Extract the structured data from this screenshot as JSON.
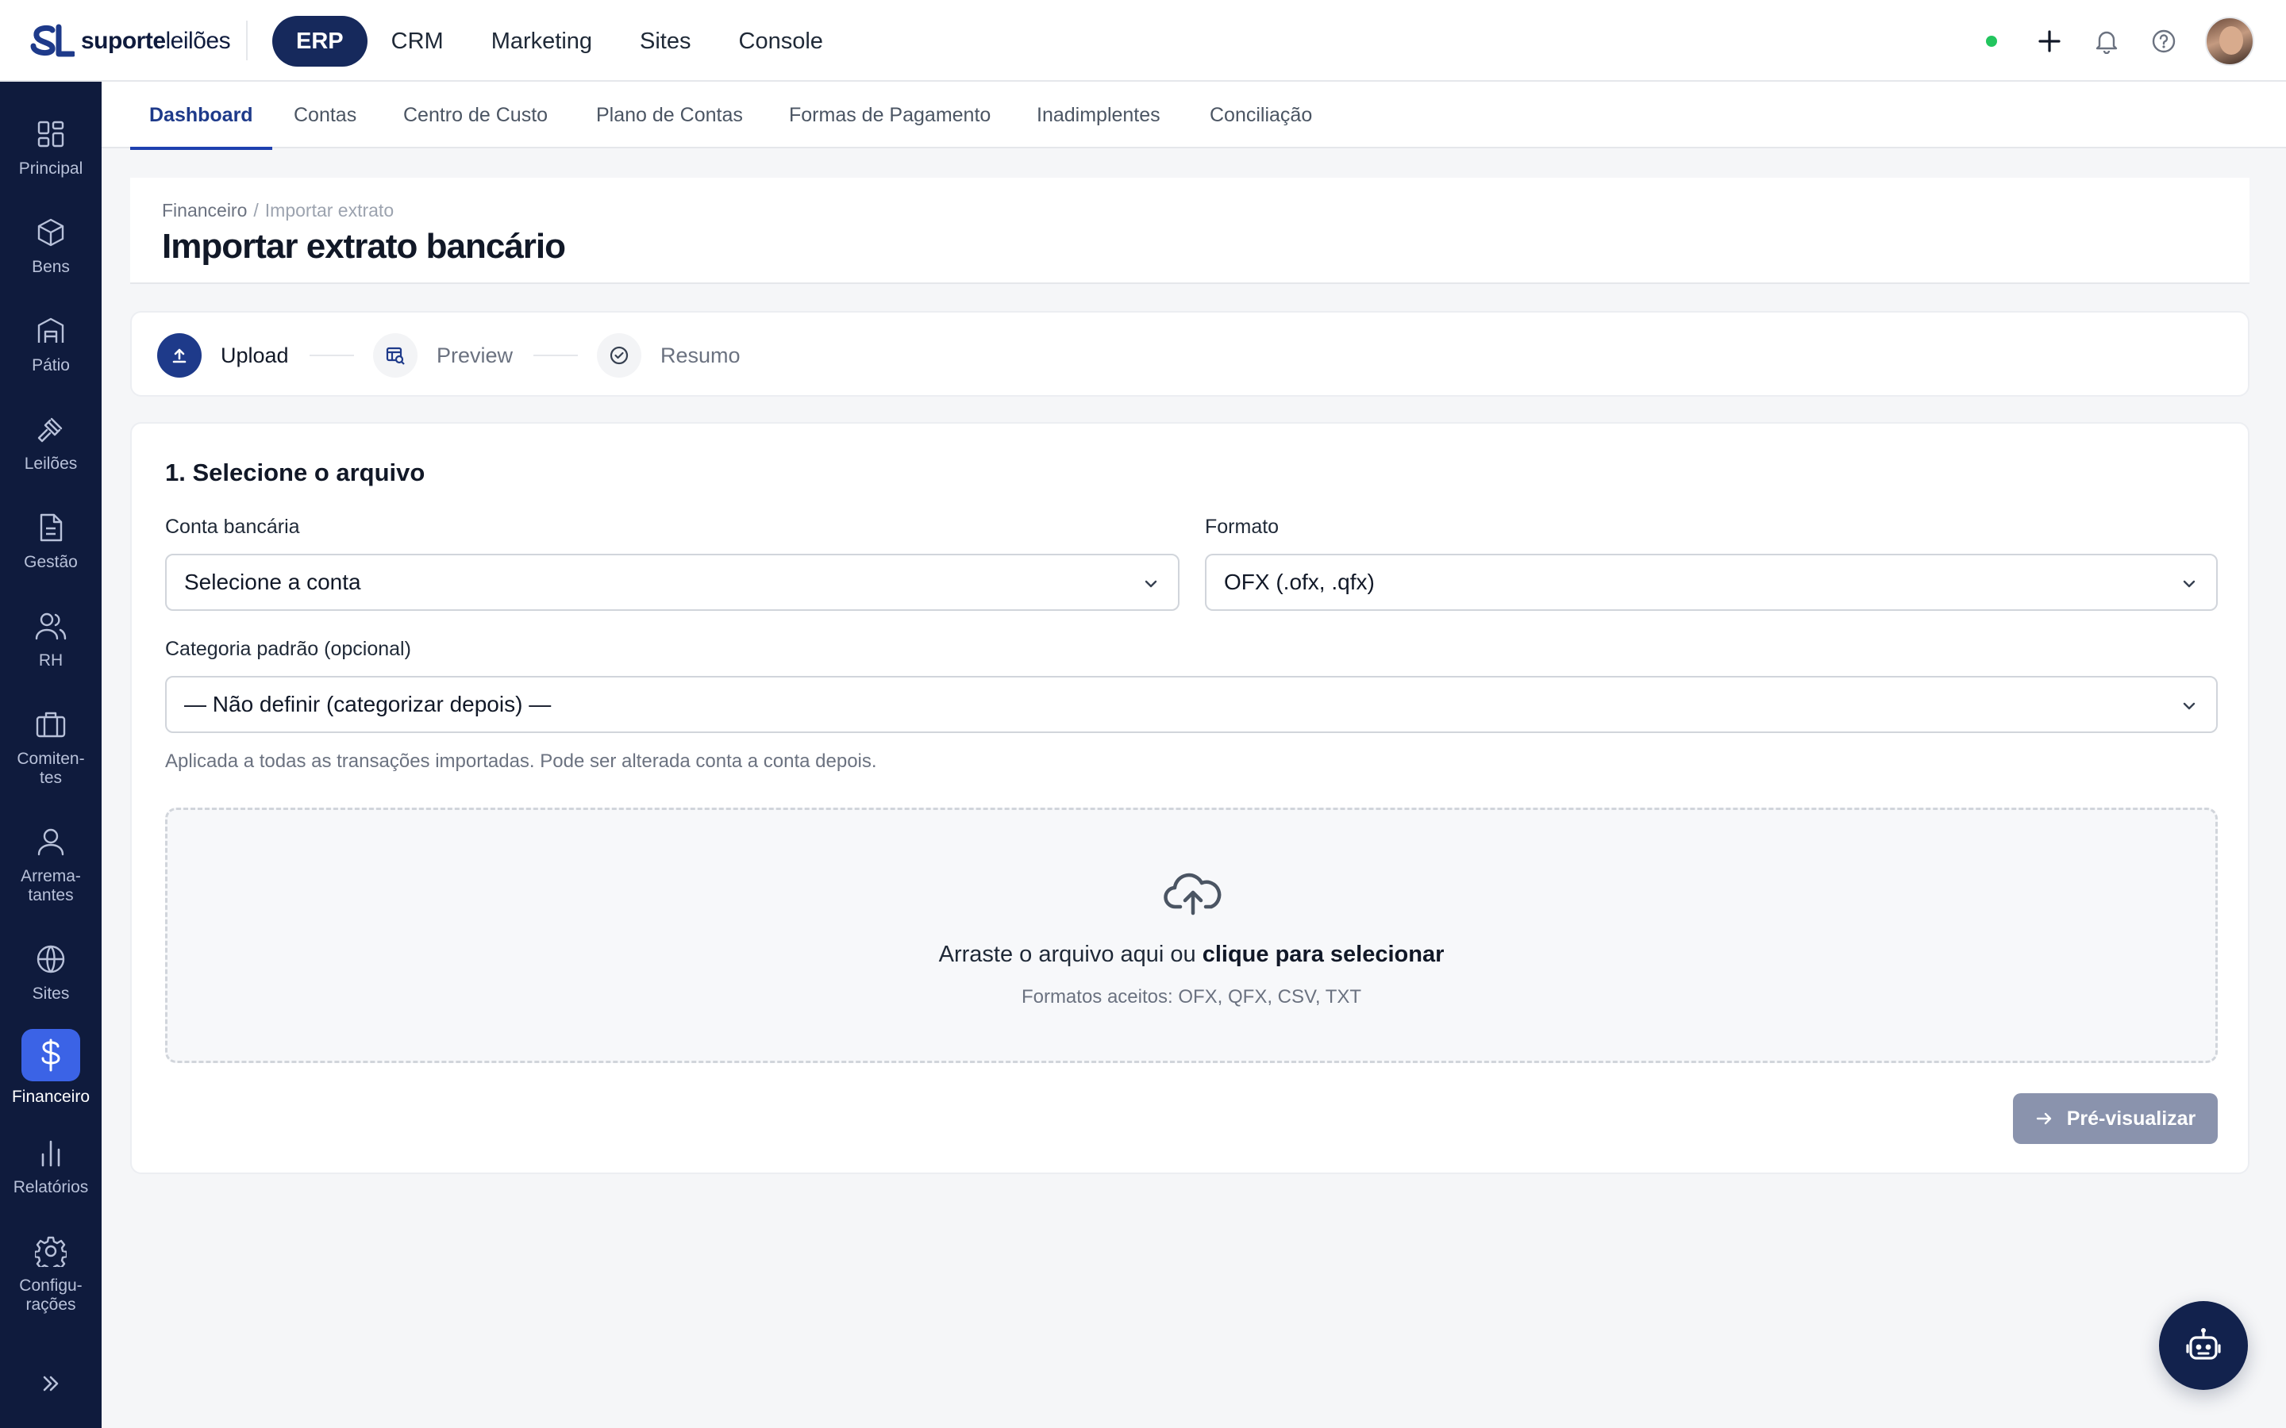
{
  "brand": {
    "logo_mark": "SL",
    "name_bold": "suporte",
    "name_light": "leilões"
  },
  "modules": [
    {
      "label": "ERP",
      "active": true
    },
    {
      "label": "CRM",
      "active": false
    },
    {
      "label": "Marketing",
      "active": false
    },
    {
      "label": "Sites",
      "active": false
    },
    {
      "label": "Console",
      "active": false
    }
  ],
  "topbar_icons": [
    "status-online-dot",
    "plus-icon",
    "bell-icon",
    "help-icon",
    "user-avatar"
  ],
  "sidebar": {
    "items": [
      {
        "label": "Principal",
        "icon": "grid-icon"
      },
      {
        "label": "Bens",
        "icon": "box-icon"
      },
      {
        "label": "Pátio",
        "icon": "warehouse-icon"
      },
      {
        "label": "Leilões",
        "icon": "gavel-icon"
      },
      {
        "label": "Gestão",
        "icon": "document-icon"
      },
      {
        "label": "RH",
        "icon": "users-icon"
      },
      {
        "label_line1": "Comiten-",
        "label_line2": "tes",
        "icon": "briefcase-icon"
      },
      {
        "label_line1": "Arrema-",
        "label_line2": "tantes",
        "icon": "user-icon"
      },
      {
        "label": "Sites",
        "icon": "globe-icon"
      },
      {
        "label": "Financeiro",
        "icon": "dollar-icon",
        "active": true
      },
      {
        "label": "Relatórios",
        "icon": "bar-chart-icon"
      },
      {
        "label_line1": "Configu-",
        "label_line2": "rações",
        "icon": "gear-icon"
      }
    ],
    "collapse_icon": "chevrons-right-icon"
  },
  "subnav": {
    "tabs": [
      {
        "label": "Dashboard",
        "active": true
      },
      {
        "label": "Contas"
      },
      {
        "label": "Centro de Custo"
      },
      {
        "label": "Plano de Contas"
      },
      {
        "label": "Formas de Pagamento"
      },
      {
        "label": "Inadimplentes"
      },
      {
        "label": "Conciliação"
      }
    ]
  },
  "header": {
    "breadcrumb_parent": "Financeiro",
    "breadcrumb_sep": "/",
    "breadcrumb_current": "Importar extrato",
    "title": "Importar extrato bancário"
  },
  "stepper": {
    "steps": [
      {
        "label": "Upload",
        "icon": "upload-icon",
        "active": true
      },
      {
        "label": "Preview",
        "icon": "table-preview-icon"
      },
      {
        "label": "Resumo",
        "icon": "check-circle-icon"
      }
    ]
  },
  "form": {
    "section_title": "1. Selecione o arquivo",
    "account_label": "Conta bancária",
    "account_value": "Selecione a conta",
    "format_label": "Formato",
    "format_value": "OFX (.ofx, .qfx)",
    "category_label": "Categoria padrão (opcional)",
    "category_value": "— Não definir (categorizar depois) —",
    "category_hint": "Aplicada a todas as transações importadas. Pode ser alterada conta a conta depois.",
    "dropzone_text": "Arraste o arquivo aqui ou",
    "dropzone_link": "clique para selecionar",
    "dropzone_formats": "Formatos aceitos: OFX, QFX, CSV, TXT",
    "preview_button": "Pré-visualizar"
  },
  "colors": {
    "sidebar_bg": "#0f1b3d",
    "primary": "#1e3a8a",
    "sidebar_active": "#3b63e6",
    "status_online": "#22c55e",
    "button_disabled": "#8a93ad"
  }
}
